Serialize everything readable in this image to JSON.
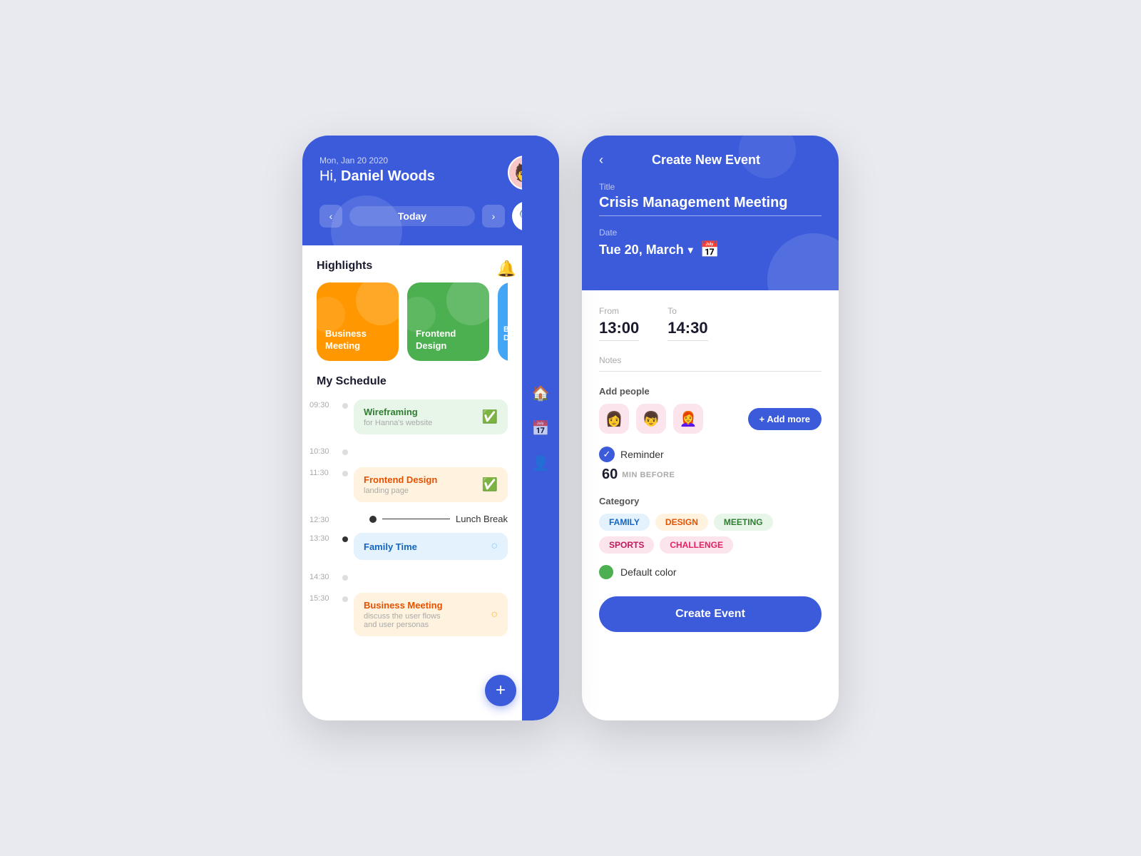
{
  "left_phone": {
    "header": {
      "date": "Mon, Jan 20 2020",
      "greeting": "Hi, ",
      "name": "Daniel Woods",
      "nav_prev": "‹",
      "nav_today": "Today",
      "nav_next": "›",
      "search_icon": "🔍"
    },
    "highlights": {
      "title": "Highlights",
      "cards": [
        {
          "label": "Business\nMeeting",
          "color": "orange"
        },
        {
          "label": "Frontend\nDesign",
          "color": "green"
        },
        {
          "label": "Ba De",
          "color": "blue"
        }
      ]
    },
    "schedule": {
      "title": "My Schedule",
      "items": [
        {
          "time": "09:30",
          "event_title": "Wireframing",
          "event_sub": "for Hanna's website",
          "color": "green",
          "icon": "✅",
          "dot": false
        },
        {
          "time": "10:30",
          "event_title": "",
          "event_sub": "",
          "color": "",
          "icon": "",
          "dot": false
        },
        {
          "time": "11:30",
          "event_title": "Frontend Design",
          "event_sub": "landing page",
          "color": "orange",
          "icon": "✅",
          "dot": false
        },
        {
          "time": "12:30",
          "label": "Lunch Break",
          "is_lunch": true
        },
        {
          "time": "13:30",
          "event_title": "Family Time",
          "event_sub": "",
          "color": "blue",
          "icon": "○",
          "dot": true
        },
        {
          "time": "14:30",
          "event_title": "",
          "event_sub": "",
          "dot": false
        },
        {
          "time": "15:30",
          "event_title": "Business Meeting",
          "event_sub": "discuss the user flows\nand user personas",
          "color": "orange",
          "icon": "○",
          "dot": false
        }
      ]
    },
    "sidebar_icons": [
      "🏠",
      "📅",
      "👤+"
    ],
    "fab": "+"
  },
  "right_phone": {
    "header": {
      "back_icon": "‹",
      "title": "Create New Event",
      "title_field_label": "Title",
      "title_value": "Crisis Management Meeting",
      "date_label": "Date",
      "date_value": "Tue 20, March",
      "chevron": "▾",
      "calendar_icon": "📅"
    },
    "body": {
      "from_label": "From",
      "from_value": "13:00",
      "to_label": "To",
      "to_value": "14:30",
      "notes_label": "Notes",
      "add_people_label": "Add people",
      "people": [
        "👩",
        "👦",
        "👩‍🦰"
      ],
      "add_more_label": "+ Add more",
      "reminder_label": "Reminder",
      "reminder_num": "60",
      "reminder_unit": "MIN BEFORE",
      "category_label": "Category",
      "categories": [
        {
          "label": "FAMILY",
          "class": "family"
        },
        {
          "label": "DESIGN",
          "class": "design"
        },
        {
          "label": "MEETING",
          "class": "meeting"
        },
        {
          "label": "SPORTS",
          "class": "sports"
        },
        {
          "label": "CHALLENGE",
          "class": "challenge"
        }
      ],
      "color_label": "Default color",
      "create_btn": "Create Event"
    }
  }
}
